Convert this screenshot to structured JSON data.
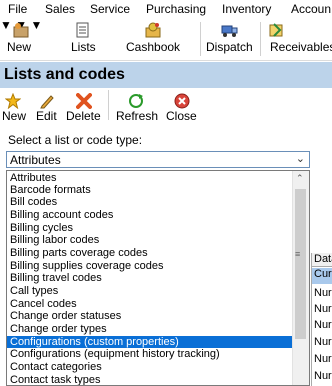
{
  "menu": [
    "File",
    "Sales",
    "Service",
    "Purchasing",
    "Inventory",
    "Accoun"
  ],
  "toolbar": {
    "new": "New",
    "lists": "Lists",
    "cashbook": "Cashbook",
    "dispatch": "Dispatch",
    "receivables": "Receivables"
  },
  "panel": {
    "title": "Lists and codes"
  },
  "actions": {
    "new": "New",
    "edit": "Edit",
    "delete": "Delete",
    "refresh": "Refresh",
    "close": "Close"
  },
  "prompt": "Select a list or code type:",
  "select": {
    "value": "Attributes"
  },
  "options": [
    "Attributes",
    "Barcode formats",
    "Bill codes",
    "Billing account codes",
    "Billing cycles",
    "Billing labor codes",
    "Billing parts coverage codes",
    "Billing supplies coverage codes",
    "Billing travel codes",
    "Call types",
    "Cancel codes",
    "Change order statuses",
    "Change order types",
    "Configurations (custom properties)",
    "Configurations (equipment history tracking)",
    "Contact categories",
    "Contact task types"
  ],
  "selected_option": "Configurations (custom properties)",
  "grid": {
    "header": "Data",
    "cells": [
      "Cur",
      "Nur",
      "Nur",
      "Nur",
      "Nur",
      "Nur",
      "Nur"
    ]
  }
}
